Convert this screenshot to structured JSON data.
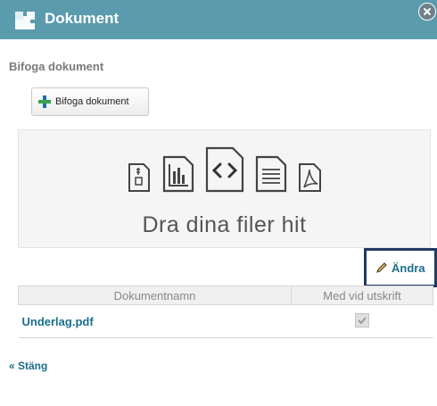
{
  "dialog": {
    "title": "Dokument",
    "section_label": "Bifoga dokument",
    "attach_button_label": "Bifoga dokument",
    "dropzone_text": "Dra dina filer hit",
    "edit_label": "Ändra",
    "close_link": "« Stäng"
  },
  "table": {
    "columns": [
      "Dokumentnamn",
      "Med vid utskrift"
    ],
    "rows": [
      {
        "name": "Underlag.pdf",
        "include_in_print": true
      }
    ]
  },
  "icons": [
    "zip-file-icon",
    "chart-file-icon",
    "code-file-icon",
    "text-file-icon",
    "pdf-file-icon"
  ],
  "colors": {
    "titlebar": "#5b9bae",
    "link": "#1a6e8d",
    "highlight_border": "#1f3a63",
    "add_green": "#3aa24b",
    "add_blue": "#1d71b8"
  }
}
